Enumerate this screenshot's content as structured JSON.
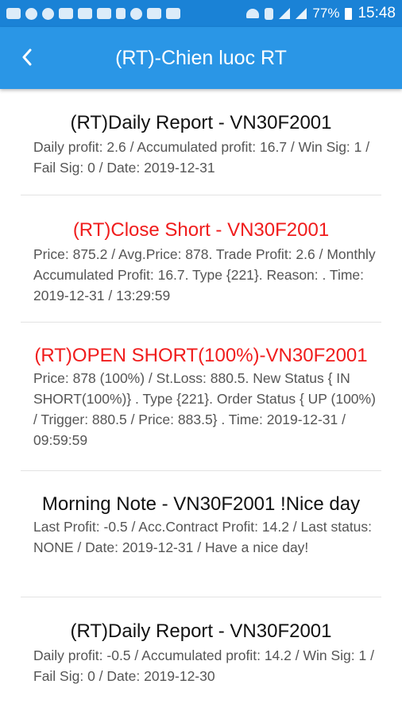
{
  "status_bar": {
    "battery": "77%",
    "time": "15:48"
  },
  "header": {
    "title": "(RT)-Chien luoc RT"
  },
  "items": [
    {
      "title": "(RT)Daily Report - VN30F2001",
      "body": "Daily profit: 2.6 / Accumulated profit: 16.7 / Win Sig: 1 / Fail Sig: 0 / Date: 2019-12-31"
    },
    {
      "title": "(RT)Close Short - VN30F2001",
      "body": "Price: 875.2 / Avg.Price: 878. Trade Profit: 2.6 / Monthly Accumulated Profit: 16.7. Type {221}. Reason: . Time: 2019-12-31 / 13:29:59"
    },
    {
      "title": "(RT)OPEN SHORT(100%)-VN30F2001",
      "body": "Price: 878 (100%) / St.Loss: 880.5. New Status { IN SHORT(100%)} . Type {221}. Order Status { UP (100%) / Trigger: 880.5 / Price: 883.5} . Time: 2019-12-31 / 09:59:59"
    },
    {
      "title": "Morning Note - VN30F2001 !Nice day",
      "body": "Last Profit: -0.5 / Acc.Contract Profit: 14.2 / Last status: NONE / Date: 2019-12-31 / Have a nice day!"
    },
    {
      "title": "(RT)Daily Report - VN30F2001",
      "body": "Daily profit: -0.5 / Accumulated profit: 14.2 / Win Sig: 1 / Fail Sig: 0 / Date: 2019-12-30"
    }
  ],
  "colors": {
    "status_bar": "#1a82d6",
    "app_bar": "#2a96e6",
    "alert_title": "#f01c1c"
  }
}
